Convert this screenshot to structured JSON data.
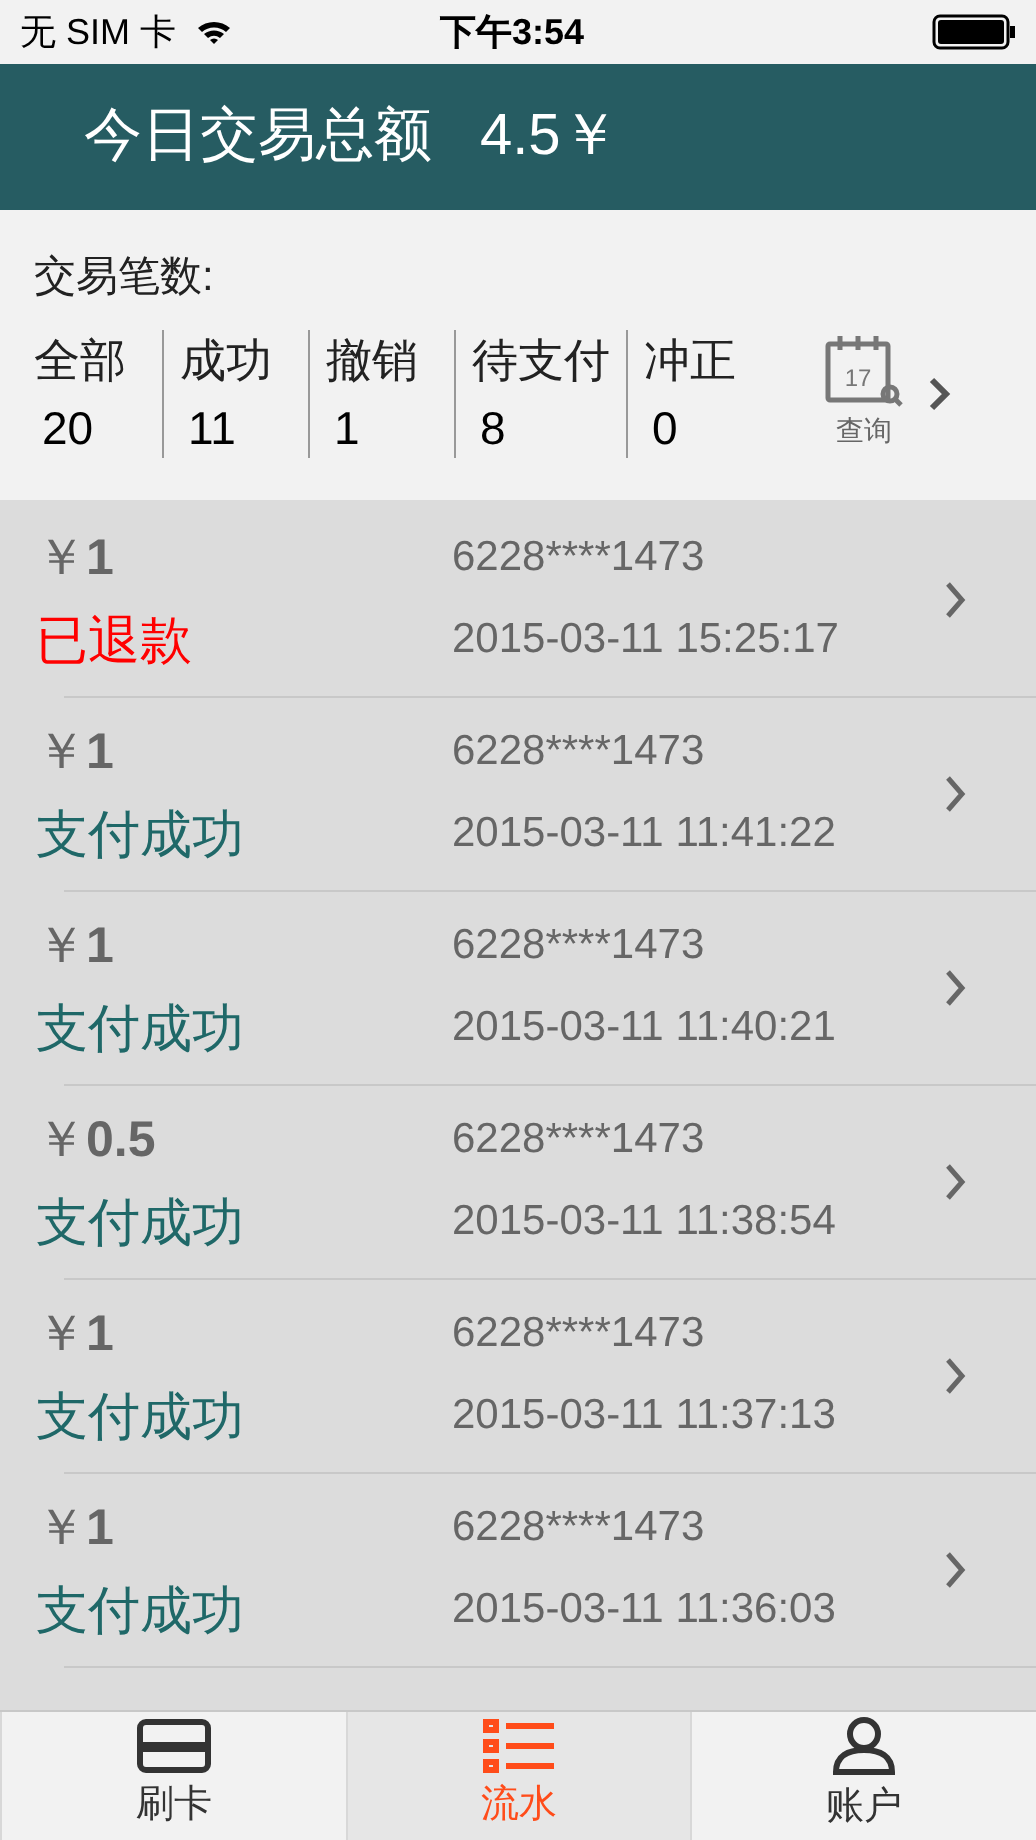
{
  "status_bar": {
    "carrier": "无 SIM 卡",
    "time": "下午3:54"
  },
  "header": {
    "title": "今日交易总额",
    "total": "4.5￥"
  },
  "stats": {
    "label": "交易笔数:",
    "items": [
      {
        "label": "全部",
        "count": "20"
      },
      {
        "label": "成功",
        "count": "11"
      },
      {
        "label": "撤销",
        "count": "1"
      },
      {
        "label": "待支付",
        "count": "8"
      },
      {
        "label": "冲正",
        "count": "0"
      }
    ],
    "query": {
      "label": "查询",
      "day": "17"
    }
  },
  "transactions": [
    {
      "amount": "1",
      "status": "已退款",
      "kind": "refunded",
      "card": "6228****1473",
      "time": "2015-03-11 15:25:17"
    },
    {
      "amount": "1",
      "status": "支付成功",
      "kind": "success",
      "card": "6228****1473",
      "time": "2015-03-11 11:41:22"
    },
    {
      "amount": "1",
      "status": "支付成功",
      "kind": "success",
      "card": "6228****1473",
      "time": "2015-03-11 11:40:21"
    },
    {
      "amount": "0.5",
      "status": "支付成功",
      "kind": "success",
      "card": "6228****1473",
      "time": "2015-03-11 11:38:54"
    },
    {
      "amount": "1",
      "status": "支付成功",
      "kind": "success",
      "card": "6228****1473",
      "time": "2015-03-11 11:37:13"
    },
    {
      "amount": "1",
      "status": "支付成功",
      "kind": "success",
      "card": "6228****1473",
      "time": "2015-03-11 11:36:03"
    }
  ],
  "currency": "￥",
  "tabs": [
    {
      "label": "刷卡",
      "selected": false
    },
    {
      "label": "流水",
      "selected": true
    },
    {
      "label": "账户",
      "selected": false
    }
  ]
}
